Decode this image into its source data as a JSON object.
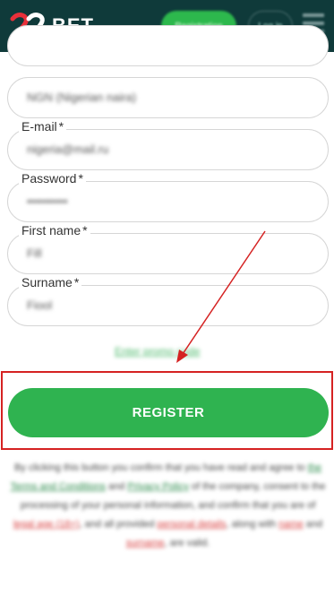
{
  "header": {
    "logo_text": "BET",
    "logo_mark": "22",
    "register_label": "Registration",
    "login_label": "Log in",
    "colors": {
      "bg": "#0f3a3a",
      "accent": "#2db84d",
      "logo_red": "#e8303a"
    }
  },
  "form": {
    "currency_value": "NGN (Nigerian naira)",
    "email": {
      "label": "E-mail",
      "required": "*",
      "value": "nigeria@mail.ru"
    },
    "password": {
      "label": "Password",
      "required": "*",
      "value": "••••••••••"
    },
    "first_name": {
      "label": "First name",
      "required": "*",
      "value": "Fill"
    },
    "surname": {
      "label": "Surname",
      "required": "*",
      "value": "Fiool"
    },
    "promo_link": "Enter promo code"
  },
  "register_button": {
    "label": "REGISTER"
  },
  "terms": {
    "p1": "By clicking this button you confirm that you have read and agree to ",
    "terms_link": "the Terms and Conditions",
    "and1": " and ",
    "privacy_link": "Privacy Policy",
    "p2": " of the company, consent to the processing of your personal information, and confirm that you are of ",
    "legal_age": "legal age (18+)",
    "p3": ", and all provided ",
    "personal_details": "personal details",
    "p4": ", along with ",
    "name_word": "name",
    "and2": " and ",
    "surname_word": "surname",
    "p5": ", are valid."
  },
  "annotation": {
    "arrow_color": "#d52222",
    "box_color": "#d52222"
  }
}
